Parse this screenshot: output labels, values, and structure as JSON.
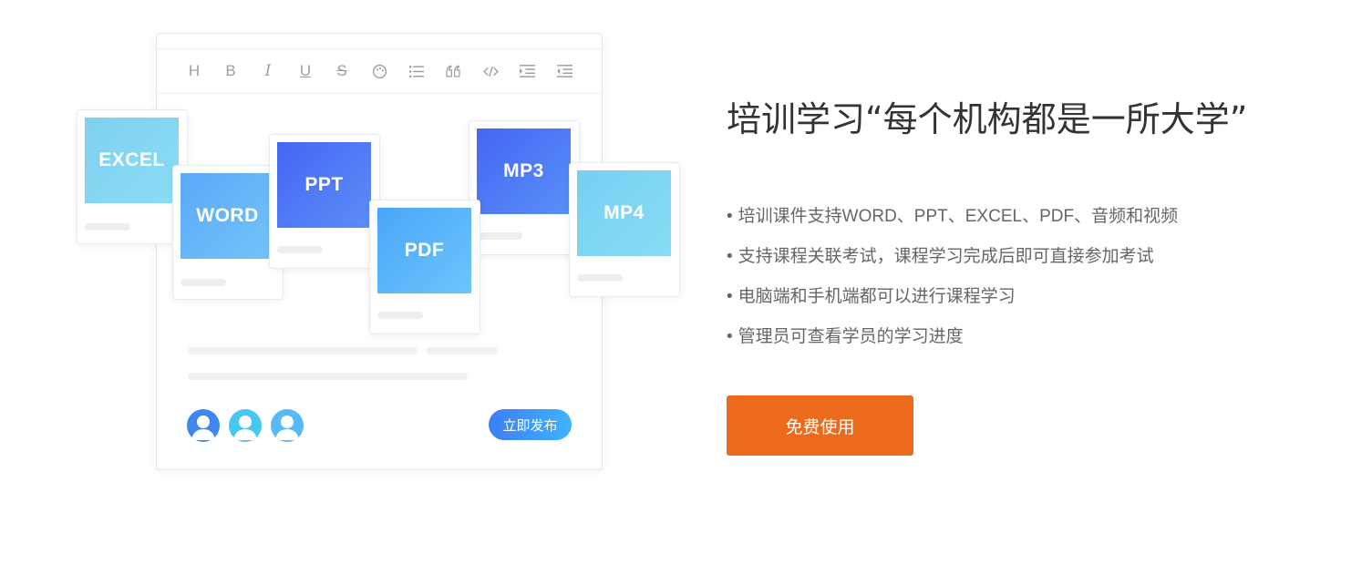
{
  "editor": {
    "toolbar": {
      "heading_glyph": "H",
      "bold_glyph": "B",
      "italic_glyph": "I",
      "underline_glyph": "U",
      "strike_glyph": "S",
      "icons": [
        "heading-icon",
        "bold-icon",
        "italic-icon",
        "underline-icon",
        "strikethrough-icon",
        "palette-icon",
        "list-icon",
        "quote-icon",
        "code-icon",
        "indent-icon",
        "outdent-icon"
      ]
    },
    "publish_label": "立即发布"
  },
  "cards": {
    "excel": {
      "label": "EXCEL",
      "color": "#86d8f2"
    },
    "word": {
      "label": "WORD",
      "color": "#66b8f8"
    },
    "ppt": {
      "label": "PPT",
      "color": "#4a7af5"
    },
    "pdf": {
      "label": "PDF",
      "color": "#58b6fb"
    },
    "mp3": {
      "label": "MP3",
      "color": "#4a7af5"
    },
    "mp4": {
      "label": "MP4",
      "color": "#7fd6f1"
    }
  },
  "content": {
    "headline": "培训学习“每个机构都是一所大学”",
    "features": [
      "培训课件支持WORD、PPT、EXCEL、PDF、音频和视频",
      "支持课程关联考试，课程学习完成后即可直接参加考试",
      "电脑端和手机端都可以进行课程学习",
      "管理员可查看学员的学习进度"
    ],
    "bullet": "•",
    "cta_label": "免费使用"
  },
  "colors": {
    "accent": "#eb6a1c",
    "publish_gradient_start": "#3d7ef5",
    "publish_gradient_end": "#3fb3ff"
  }
}
